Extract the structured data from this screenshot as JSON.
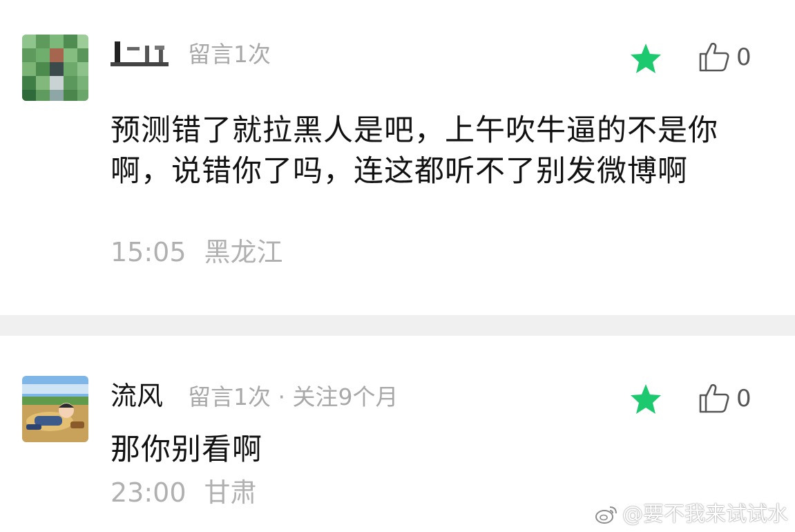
{
  "comments": [
    {
      "username": "",
      "meta": "留言1次",
      "body": "预测错了就拉黑人是吧，上午吹牛逼的不是你啊，说错你了吗，连这都听不了别发微博啊",
      "time": "15:05",
      "location": "黑龙江",
      "like_count": "0",
      "avatar_icon": "pixelated-avatar",
      "star_color": "#1dc96e"
    },
    {
      "username": "流风",
      "meta": "留言1次 · 关注9个月",
      "body": "那你别看啊",
      "time": "23:00",
      "location": "甘肃",
      "like_count": "0",
      "avatar_icon": "anime-avatar",
      "star_color": "#1dc96e"
    }
  ],
  "watermark": {
    "text": "@要不我来试试水",
    "icon": "weibo-icon"
  }
}
